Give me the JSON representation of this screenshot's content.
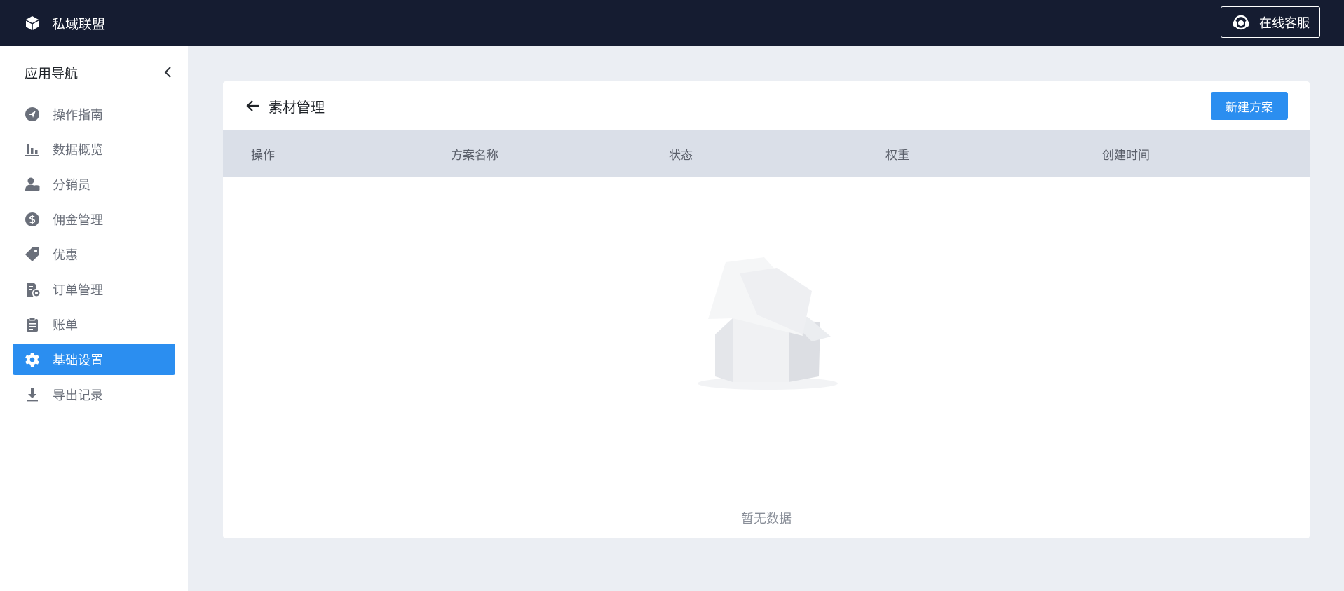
{
  "header": {
    "brand": "私域联盟",
    "service_label": "在线客服"
  },
  "sidebar": {
    "title": "应用导航",
    "items": [
      {
        "label": "操作指南",
        "icon": "compass-icon"
      },
      {
        "label": "数据概览",
        "icon": "bar-chart-icon"
      },
      {
        "label": "分销员",
        "icon": "user-coins-icon"
      },
      {
        "label": "佣金管理",
        "icon": "dollar-icon"
      },
      {
        "label": "优惠",
        "icon": "tag-icon"
      },
      {
        "label": "订单管理",
        "icon": "order-icon"
      },
      {
        "label": "账单",
        "icon": "clipboard-icon"
      },
      {
        "label": "基础设置",
        "icon": "gear-icon",
        "active": true
      },
      {
        "label": "导出记录",
        "icon": "download-icon"
      }
    ]
  },
  "main": {
    "title": "素材管理",
    "new_button": "新建方案",
    "columns": [
      "操作",
      "方案名称",
      "状态",
      "权重",
      "创建时间"
    ],
    "empty_text": "暂无数据"
  },
  "colors": {
    "header_bg": "#151c31",
    "accent": "#2b8ef0",
    "table_head": "#dadfe8",
    "page_bg": "#ebeef3"
  }
}
